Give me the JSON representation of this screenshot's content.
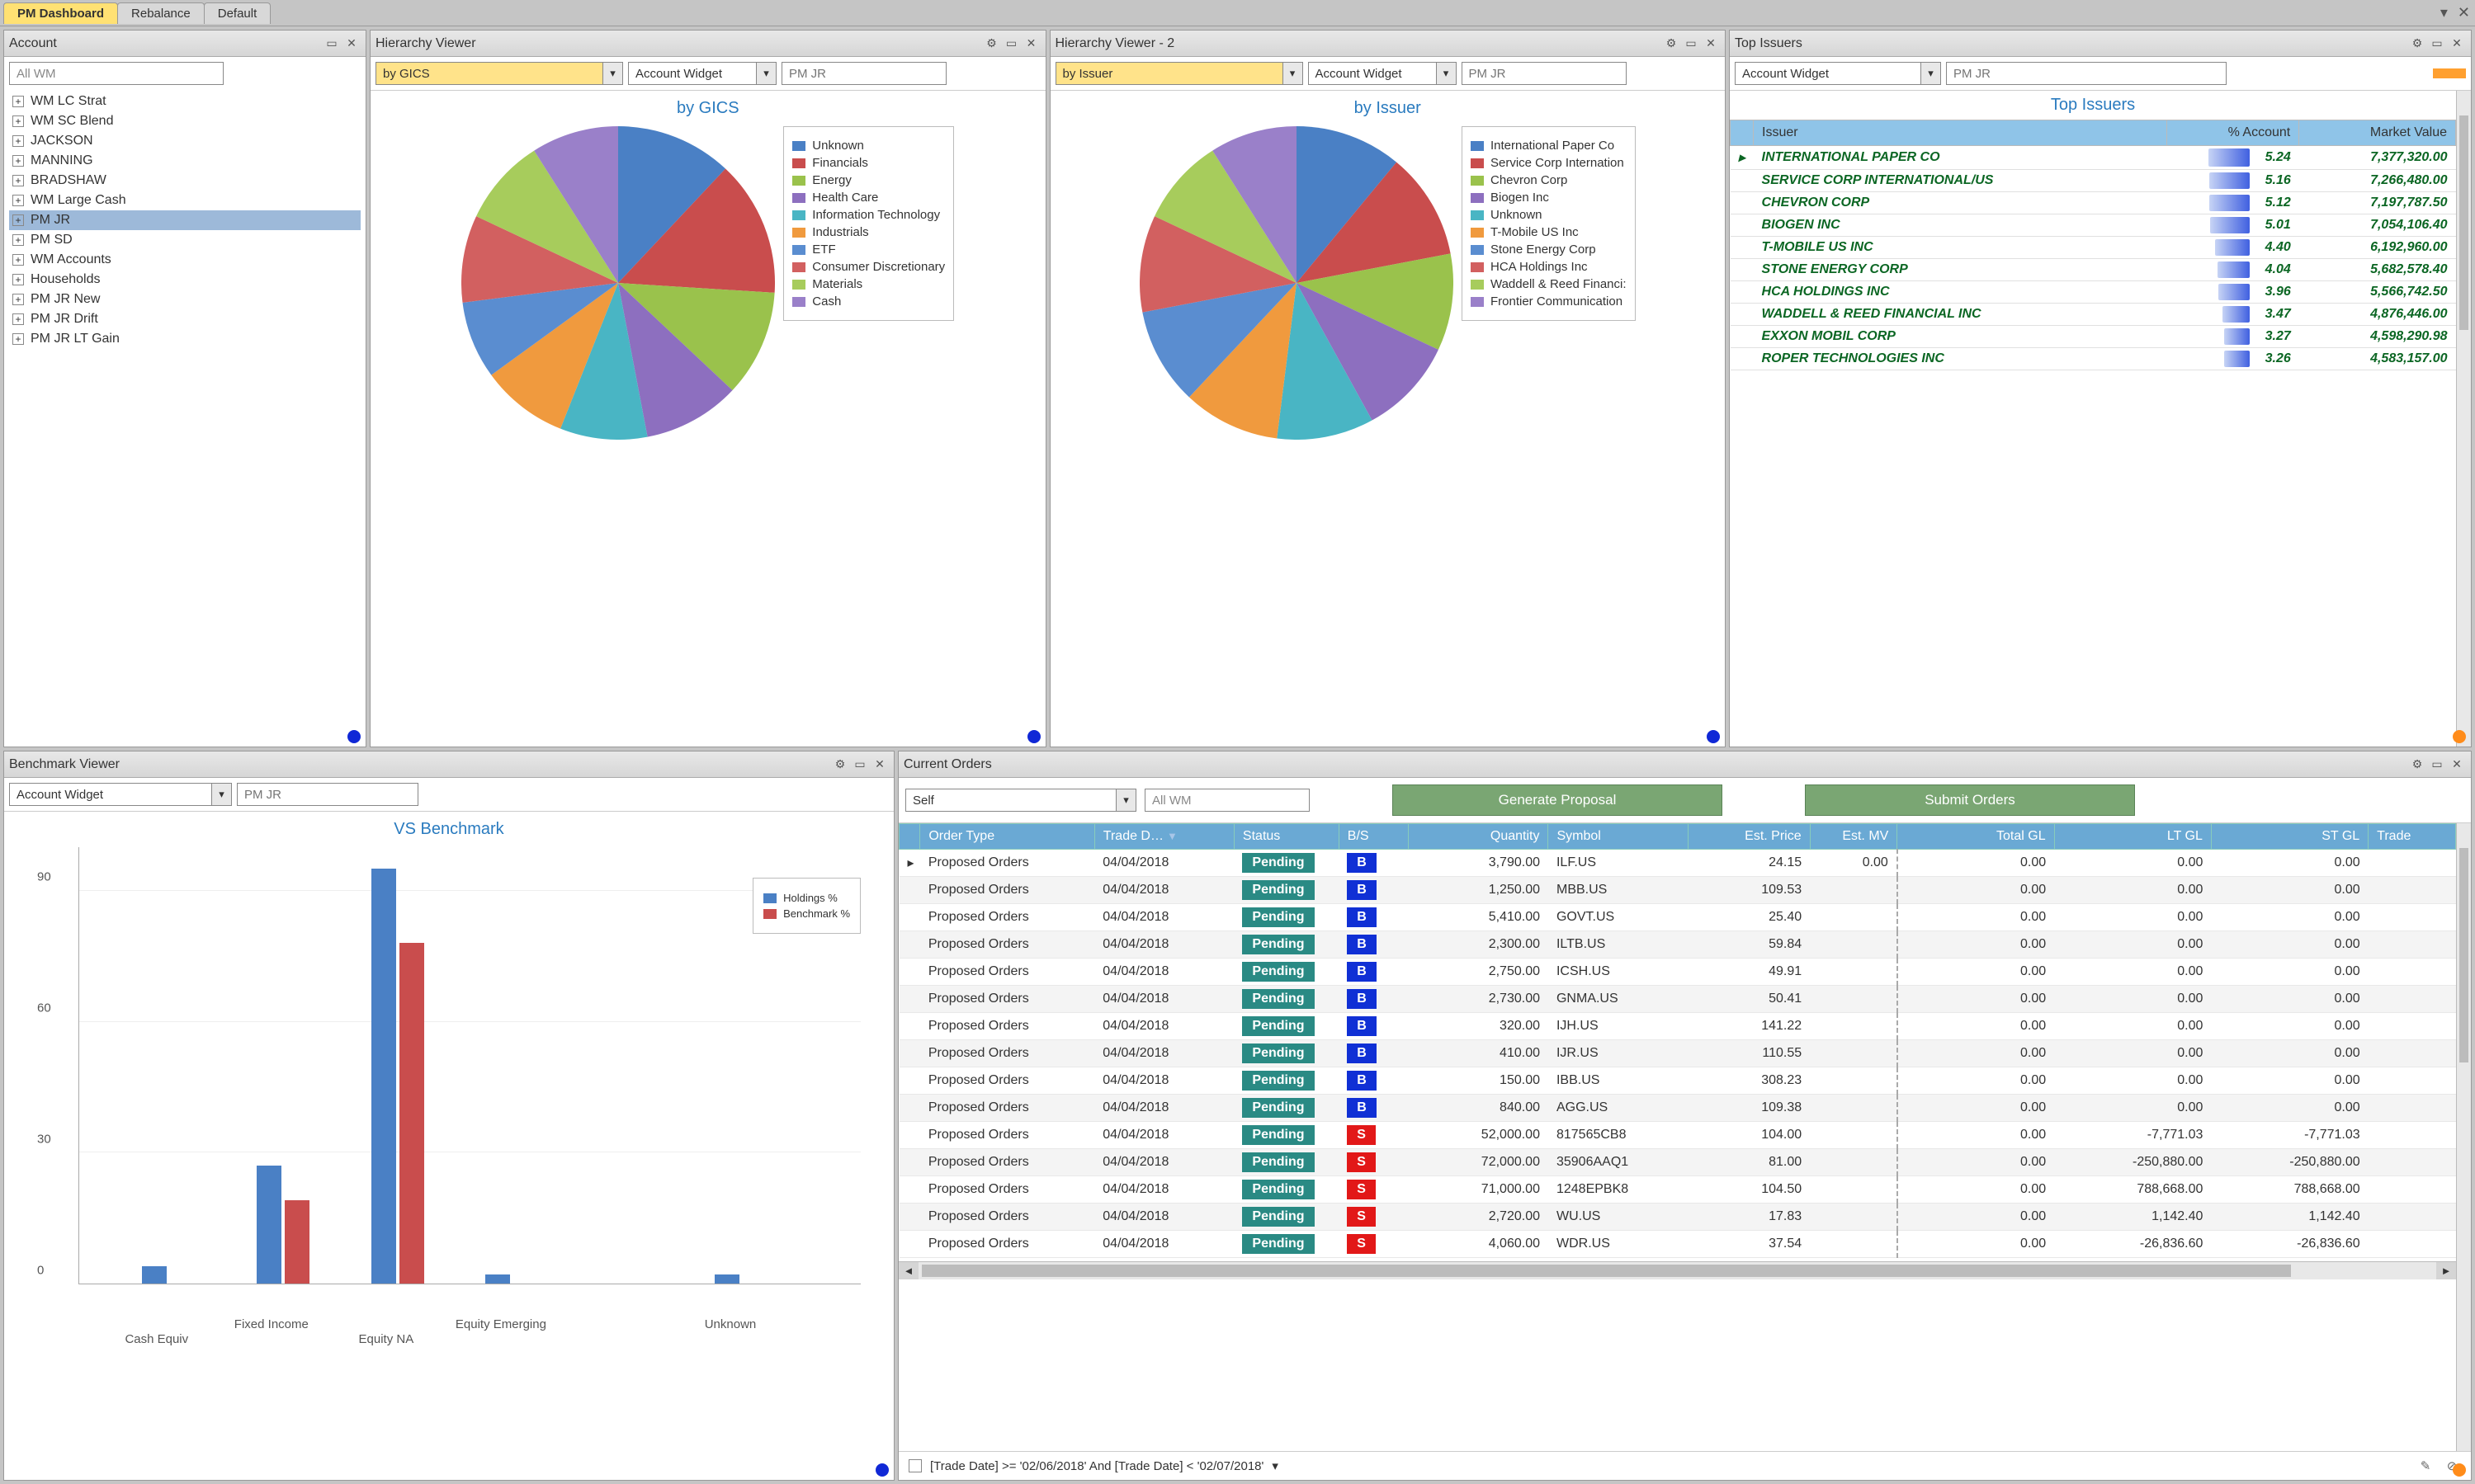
{
  "tabs": {
    "dashboard": "PM Dashboard",
    "rebalance": "Rebalance",
    "default": "Default"
  },
  "panels": {
    "account": {
      "title": "Account",
      "search": "All WM"
    },
    "hv1": {
      "title": "Hierarchy Viewer",
      "dropdown": "by GICS",
      "widget_label": "Account Widget",
      "user": "PM JR",
      "chart_title": "by GICS"
    },
    "hv2": {
      "title": "Hierarchy Viewer - 2",
      "dropdown": "by Issuer",
      "widget_label": "Account Widget",
      "user": "PM JR",
      "chart_title": "by Issuer"
    },
    "top_issuers": {
      "title": "Top Issuers",
      "widget_label": "Account Widget",
      "user": "PM JR",
      "grid_title": "Top Issuers"
    },
    "benchmark": {
      "title": "Benchmark Viewer",
      "widget_label": "Account Widget",
      "user": "PM JR",
      "chart_title": "VS Benchmark"
    },
    "orders": {
      "title": "Current Orders",
      "self": "Self",
      "account": "All WM",
      "generate": "Generate Proposal",
      "submit": "Submit Orders",
      "filter_text": "[Trade Date] >= '02/06/2018' And [Trade Date] < '02/07/2018'"
    }
  },
  "tree": [
    "WM LC Strat",
    "WM SC Blend",
    "JACKSON",
    "MANNING",
    "BRADSHAW",
    "WM Large Cash",
    "PM JR",
    "PM SD",
    "WM Accounts",
    "Households",
    "PM JR New",
    "PM JR Drift",
    "PM JR LT Gain"
  ],
  "tree_selected": 6,
  "top_issuers_cols": {
    "issuer": "Issuer",
    "pct": "% Account",
    "mv": "Market Value"
  },
  "top_issuers": [
    {
      "name": "INTERNATIONAL PAPER CO",
      "pct": "5.24",
      "mv": "7,377,320.00",
      "barw": 100
    },
    {
      "name": "SERVICE CORP INTERNATIONAL/US",
      "pct": "5.16",
      "mv": "7,266,480.00",
      "barw": 98
    },
    {
      "name": "CHEVRON CORP",
      "pct": "5.12",
      "mv": "7,197,787.50",
      "barw": 97
    },
    {
      "name": "BIOGEN INC",
      "pct": "5.01",
      "mv": "7,054,106.40",
      "barw": 95
    },
    {
      "name": "T-MOBILE US INC",
      "pct": "4.40",
      "mv": "6,192,960.00",
      "barw": 84
    },
    {
      "name": "STONE ENERGY CORP",
      "pct": "4.04",
      "mv": "5,682,578.40",
      "barw": 77
    },
    {
      "name": "HCA HOLDINGS INC",
      "pct": "3.96",
      "mv": "5,566,742.50",
      "barw": 75
    },
    {
      "name": "WADDELL & REED FINANCIAL INC",
      "pct": "3.47",
      "mv": "4,876,446.00",
      "barw": 66
    },
    {
      "name": "EXXON MOBIL CORP",
      "pct": "3.27",
      "mv": "4,598,290.98",
      "barw": 62
    },
    {
      "name": "ROPER TECHNOLOGIES INC",
      "pct": "3.26",
      "mv": "4,583,157.00",
      "barw": 62
    }
  ],
  "chart_data": [
    {
      "id": "gics_pie",
      "type": "pie",
      "title": "by GICS",
      "series": [
        {
          "name": "Unknown",
          "value": 12,
          "color": "#4a80c5"
        },
        {
          "name": "Financials",
          "value": 14,
          "color": "#c94d4d"
        },
        {
          "name": "Energy",
          "value": 11,
          "color": "#9ac24c"
        },
        {
          "name": "Health Care",
          "value": 10,
          "color": "#8d6fbf"
        },
        {
          "name": "Information Technology",
          "value": 9,
          "color": "#49b5c4"
        },
        {
          "name": "Industrials",
          "value": 9,
          "color": "#f09a3e"
        },
        {
          "name": "ETF",
          "value": 8,
          "color": "#5a8dd0"
        },
        {
          "name": "Consumer Discretionary",
          "value": 9,
          "color": "#d26060"
        },
        {
          "name": "Materials",
          "value": 9,
          "color": "#a7cc5c"
        },
        {
          "name": "Cash",
          "value": 9,
          "color": "#9a80c9"
        }
      ]
    },
    {
      "id": "issuer_pie",
      "type": "pie",
      "title": "by Issuer",
      "series": [
        {
          "name": "International Paper Co",
          "value": 11,
          "color": "#4a80c5"
        },
        {
          "name": "Service Corp Internation",
          "value": 11,
          "color": "#c94d4d"
        },
        {
          "name": "Chevron Corp",
          "value": 10,
          "color": "#9ac24c"
        },
        {
          "name": "Biogen Inc",
          "value": 10,
          "color": "#8d6fbf"
        },
        {
          "name": "Unknown",
          "value": 10,
          "color": "#49b5c4"
        },
        {
          "name": "T-Mobile US Inc",
          "value": 10,
          "color": "#f09a3e"
        },
        {
          "name": "Stone Energy Corp",
          "value": 10,
          "color": "#5a8dd0"
        },
        {
          "name": "HCA Holdings Inc",
          "value": 10,
          "color": "#d26060"
        },
        {
          "name": "Waddell & Reed Financi:",
          "value": 9,
          "color": "#a7cc5c"
        },
        {
          "name": "Frontier Communication",
          "value": 9,
          "color": "#9a80c9"
        }
      ]
    },
    {
      "id": "benchmark_bar",
      "type": "bar",
      "title": "VS Benchmark",
      "categories": [
        "Cash Equiv",
        "Fixed Income",
        "Equity NA",
        "Equity Emerging",
        "",
        "Unknown"
      ],
      "series": [
        {
          "name": "Holdings %",
          "color": "#4a80c5",
          "values": [
            4,
            27,
            95,
            2,
            0,
            2
          ]
        },
        {
          "name": "Benchmark %",
          "color": "#c94d4d",
          "values": [
            0,
            19,
            78,
            0,
            0,
            0
          ]
        }
      ],
      "ylim": [
        0,
        100
      ],
      "yticks": [
        0,
        30,
        60,
        90
      ]
    }
  ],
  "orders_cols": [
    "Order Type",
    "Trade D…",
    "Status",
    "B/S",
    "Quantity",
    "Symbol",
    "Est. Price",
    "Est. MV",
    "Total GL",
    "LT GL",
    "ST GL",
    "Trade"
  ],
  "orders_sorted_col": 1,
  "orders": [
    {
      "type": "Proposed Orders",
      "date": "04/04/2018",
      "status": "Pending",
      "bs": "B",
      "qty": "3,790.00",
      "sym": "ILF.US",
      "price": "24.15",
      "mv": "0.00",
      "tgl": "0.00",
      "ltgl": "0.00",
      "stgl": "0.00"
    },
    {
      "type": "Proposed Orders",
      "date": "04/04/2018",
      "status": "Pending",
      "bs": "B",
      "qty": "1,250.00",
      "sym": "MBB.US",
      "price": "109.53",
      "mv": "",
      "tgl": "0.00",
      "ltgl": "0.00",
      "stgl": "0.00"
    },
    {
      "type": "Proposed Orders",
      "date": "04/04/2018",
      "status": "Pending",
      "bs": "B",
      "qty": "5,410.00",
      "sym": "GOVT.US",
      "price": "25.40",
      "mv": "",
      "tgl": "0.00",
      "ltgl": "0.00",
      "stgl": "0.00"
    },
    {
      "type": "Proposed Orders",
      "date": "04/04/2018",
      "status": "Pending",
      "bs": "B",
      "qty": "2,300.00",
      "sym": "ILTB.US",
      "price": "59.84",
      "mv": "",
      "tgl": "0.00",
      "ltgl": "0.00",
      "stgl": "0.00"
    },
    {
      "type": "Proposed Orders",
      "date": "04/04/2018",
      "status": "Pending",
      "bs": "B",
      "qty": "2,750.00",
      "sym": "ICSH.US",
      "price": "49.91",
      "mv": "",
      "tgl": "0.00",
      "ltgl": "0.00",
      "stgl": "0.00"
    },
    {
      "type": "Proposed Orders",
      "date": "04/04/2018",
      "status": "Pending",
      "bs": "B",
      "qty": "2,730.00",
      "sym": "GNMA.US",
      "price": "50.41",
      "mv": "",
      "tgl": "0.00",
      "ltgl": "0.00",
      "stgl": "0.00"
    },
    {
      "type": "Proposed Orders",
      "date": "04/04/2018",
      "status": "Pending",
      "bs": "B",
      "qty": "320.00",
      "sym": "IJH.US",
      "price": "141.22",
      "mv": "",
      "tgl": "0.00",
      "ltgl": "0.00",
      "stgl": "0.00"
    },
    {
      "type": "Proposed Orders",
      "date": "04/04/2018",
      "status": "Pending",
      "bs": "B",
      "qty": "410.00",
      "sym": "IJR.US",
      "price": "110.55",
      "mv": "",
      "tgl": "0.00",
      "ltgl": "0.00",
      "stgl": "0.00"
    },
    {
      "type": "Proposed Orders",
      "date": "04/04/2018",
      "status": "Pending",
      "bs": "B",
      "qty": "150.00",
      "sym": "IBB.US",
      "price": "308.23",
      "mv": "",
      "tgl": "0.00",
      "ltgl": "0.00",
      "stgl": "0.00"
    },
    {
      "type": "Proposed Orders",
      "date": "04/04/2018",
      "status": "Pending",
      "bs": "B",
      "qty": "840.00",
      "sym": "AGG.US",
      "price": "109.38",
      "mv": "",
      "tgl": "0.00",
      "ltgl": "0.00",
      "stgl": "0.00"
    },
    {
      "type": "Proposed Orders",
      "date": "04/04/2018",
      "status": "Pending",
      "bs": "S",
      "qty": "52,000.00",
      "sym": "817565CB8",
      "price": "104.00",
      "mv": "",
      "tgl": "0.00",
      "ltgl": "-7,771.03",
      "stgl": "-7,771.03"
    },
    {
      "type": "Proposed Orders",
      "date": "04/04/2018",
      "status": "Pending",
      "bs": "S",
      "qty": "72,000.00",
      "sym": "35906AAQ1",
      "price": "81.00",
      "mv": "",
      "tgl": "0.00",
      "ltgl": "-250,880.00",
      "stgl": "-250,880.00"
    },
    {
      "type": "Proposed Orders",
      "date": "04/04/2018",
      "status": "Pending",
      "bs": "S",
      "qty": "71,000.00",
      "sym": "1248EPBK8",
      "price": "104.50",
      "mv": "",
      "tgl": "0.00",
      "ltgl": "788,668.00",
      "stgl": "788,668.00"
    },
    {
      "type": "Proposed Orders",
      "date": "04/04/2018",
      "status": "Pending",
      "bs": "S",
      "qty": "2,720.00",
      "sym": "WU.US",
      "price": "17.83",
      "mv": "",
      "tgl": "0.00",
      "ltgl": "1,142.40",
      "stgl": "1,142.40"
    },
    {
      "type": "Proposed Orders",
      "date": "04/04/2018",
      "status": "Pending",
      "bs": "S",
      "qty": "4,060.00",
      "sym": "WDR.US",
      "price": "37.54",
      "mv": "",
      "tgl": "0.00",
      "ltgl": "-26,836.60",
      "stgl": "-26,836.60"
    }
  ]
}
